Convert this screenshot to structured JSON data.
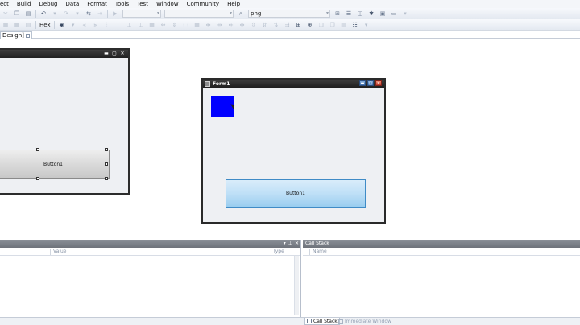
{
  "menu": [
    "ect",
    "Build",
    "Debug",
    "Data",
    "Format",
    "Tools",
    "Test",
    "Window",
    "Community",
    "Help"
  ],
  "toolbar": {
    "hex_label": "Hex",
    "find_combo_value": "png"
  },
  "document_tab": {
    "label": "Design]"
  },
  "design_form": {
    "button_label": "Button1"
  },
  "form1": {
    "title": "Form1",
    "button_label": "Button1",
    "box_color": "#0000ff"
  },
  "left_panel": {
    "columns": [
      "Value",
      "Type"
    ]
  },
  "right_panel": {
    "title": "Call Stack",
    "columns": [
      "Name"
    ]
  },
  "bottom_tabs": [
    "Call Stack",
    "Immediate Window"
  ],
  "colors": {
    "form_border": "#2a2a2a",
    "runtime_button": "#bfe0f7",
    "panel_header": "#7a7f87"
  }
}
